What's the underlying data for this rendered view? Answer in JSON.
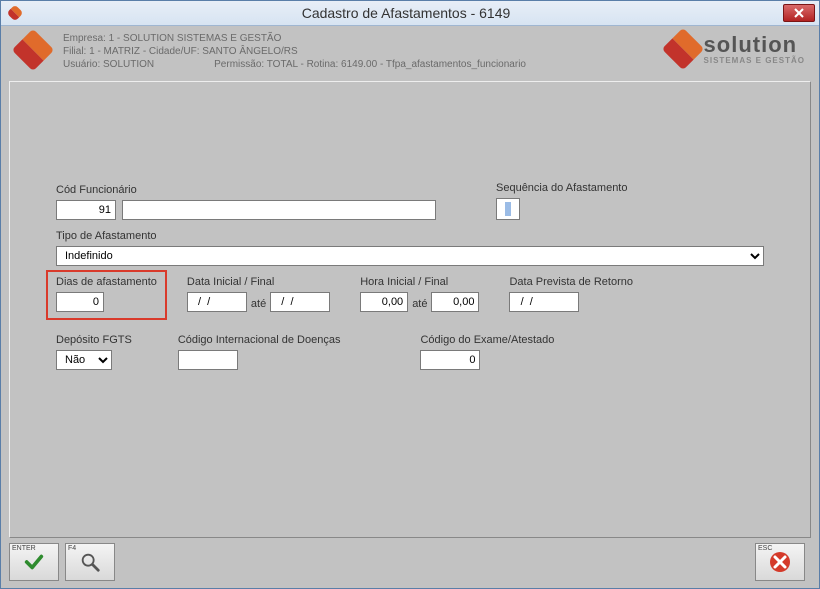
{
  "window": {
    "title": "Cadastro de Afastamentos - 6149"
  },
  "header": {
    "empresa": "Empresa: 1 - SOLUTION SISTEMAS E GESTÃO",
    "filial": "Filial: 1 - MATRIZ - Cidade/UF: SANTO ÂNGELO/RS",
    "usuario_label": "Usuário: SOLUTION",
    "permissao": "Permissão: TOTAL - Rotina: 6149.00 - Tfpa_afastamentos_funcionario",
    "brand_main": "solution",
    "brand_sub": "SISTEMAS E GESTÃO"
  },
  "form": {
    "cod_func_label": "Cód Funcionário",
    "cod_func_value": "91",
    "cod_func_name": "",
    "seq_label": "Sequência do Afastamento",
    "tipo_label": "Tipo de Afastamento",
    "tipo_value": "Indefinido",
    "dias_label": "Dias de afastamento",
    "dias_value": "0",
    "data_if_label": "Data Inicial / Final",
    "data_ini": "  /  /",
    "data_fim": "  /  /",
    "ate": "até",
    "hora_if_label": "Hora Inicial / Final",
    "hora_ini": "0,00",
    "hora_fim": "0,00",
    "data_prev_label": "Data Prevista de Retorno",
    "data_prev": "  /  /",
    "dep_fgts_label": "Depósito FGTS",
    "dep_fgts_value": "Não",
    "cid_label": "Código Internacional de Doenças",
    "cid_value": "",
    "cod_exame_label": "Código do Exame/Atestado",
    "cod_exame_value": "0"
  },
  "footer": {
    "enter": "ENTER",
    "f4": "F4",
    "esc": "ESC"
  }
}
